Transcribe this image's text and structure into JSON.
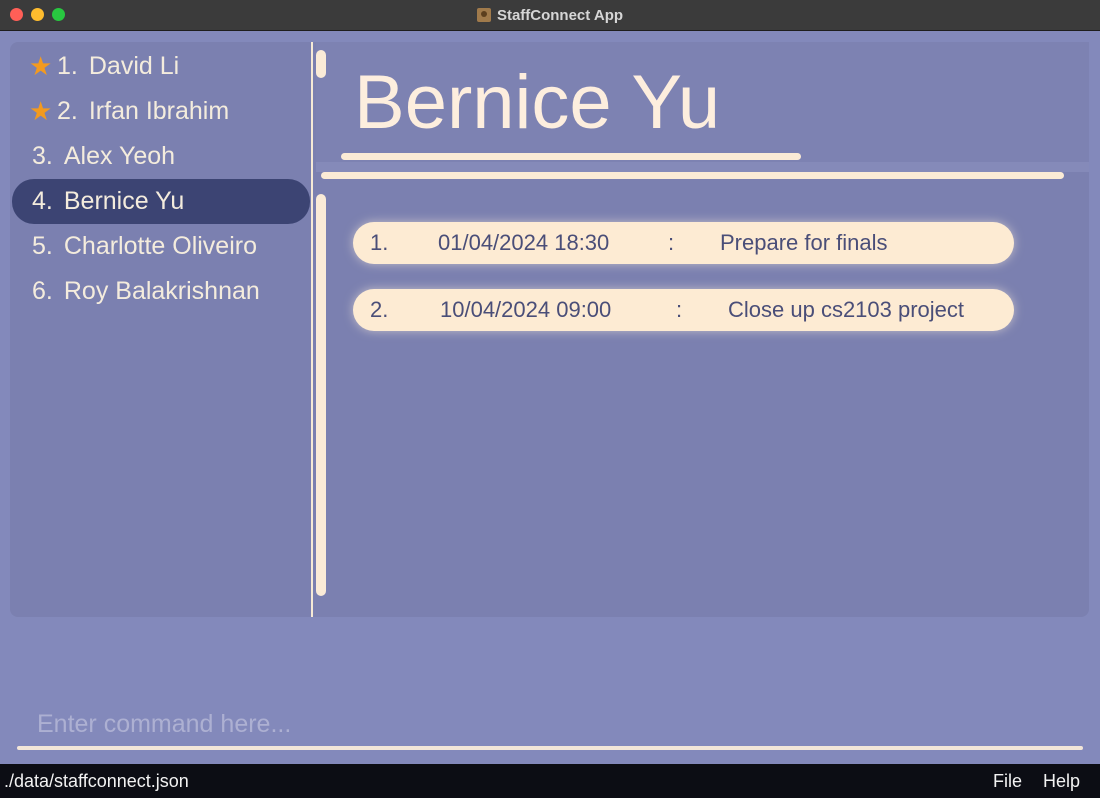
{
  "window": {
    "title": "StaffConnect App"
  },
  "staff_list": [
    {
      "index": "1.",
      "name": "David Li",
      "favourite": true,
      "selected": false
    },
    {
      "index": "2.",
      "name": "Irfan Ibrahim",
      "favourite": true,
      "selected": false
    },
    {
      "index": "3.",
      "name": "Alex Yeoh",
      "favourite": false,
      "selected": false
    },
    {
      "index": "4.",
      "name": "Bernice Yu",
      "favourite": false,
      "selected": true
    },
    {
      "index": "5.",
      "name": "Charlotte Oliveiro",
      "favourite": false,
      "selected": false
    },
    {
      "index": "6.",
      "name": "Roy Balakrishnan",
      "favourite": false,
      "selected": false
    }
  ],
  "detail": {
    "name": "Bernice Yu",
    "meetings": [
      {
        "index": "1.",
        "datetime": "01/04/2024 18:30",
        "separator": ":",
        "description": "Prepare for finals"
      },
      {
        "index": "2.",
        "datetime": "10/04/2024 09:00",
        "separator": ":",
        "description": "Close up cs2103 project"
      }
    ]
  },
  "command": {
    "placeholder": "Enter command here..."
  },
  "status_bar": {
    "path": "./data/staffconnect.json"
  },
  "menu": {
    "file": "File",
    "help": "Help"
  },
  "colors": {
    "background": "#8389bb",
    "panel": "#7b80b0",
    "selected_item": "#3c4473",
    "accent_cream": "#fbebd6",
    "star": "#f39a1f"
  },
  "icons": {
    "favourite": "star-icon",
    "app": "app-icon"
  }
}
